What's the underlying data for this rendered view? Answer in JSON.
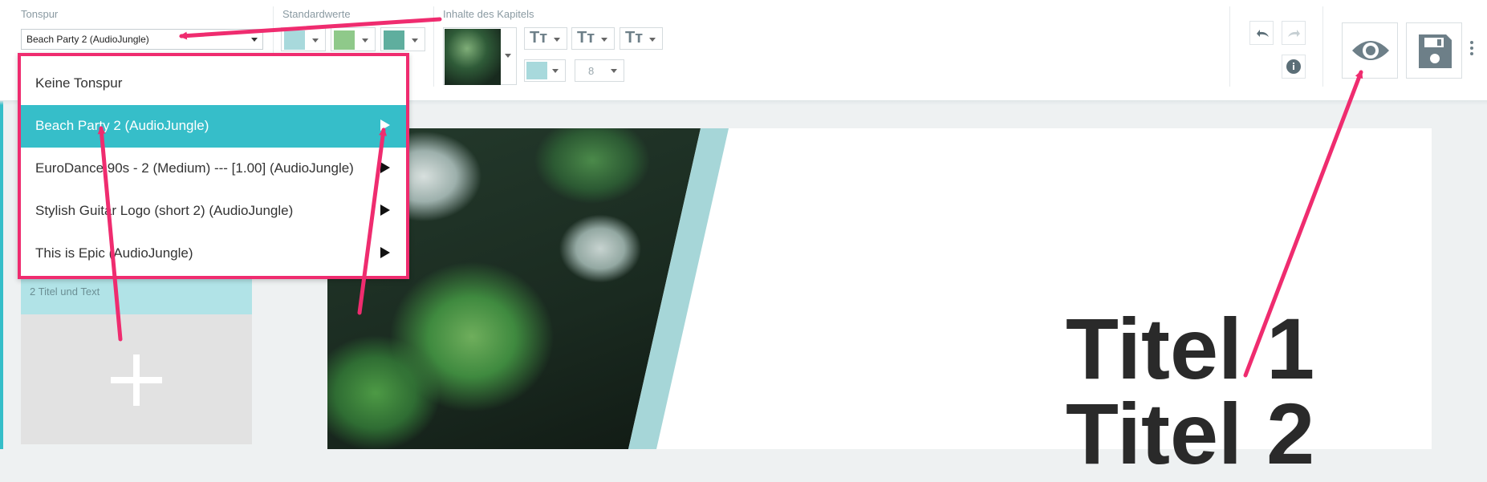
{
  "toolbar": {
    "sections": {
      "tonspur": "Tonspur",
      "standardwerte": "Standardwerte",
      "inhalte": "Inhalte des Kapitels"
    },
    "track_select_value": "Beach Party 2 (AudioJungle)",
    "standard_swatches": [
      "#a8d9dc",
      "#8fc98a",
      "#5fae9e"
    ],
    "font_buttons": [
      "Tт",
      "Tт",
      "Tт"
    ],
    "text_color_swatch": "#a8d9dc",
    "font_size_value": "8",
    "undo_icon": "undo-icon",
    "redo_icon": "redo-icon",
    "info_icon": "info-icon",
    "preview_icon": "eye-icon",
    "save_icon": "floppy-disk-icon",
    "more_icon": "vertical-dots-icon"
  },
  "dropdown": {
    "items": [
      {
        "label": "Keine Tonspur",
        "has_play": false,
        "active": false
      },
      {
        "label": "Beach Party 2 (AudioJungle)",
        "has_play": true,
        "active": true
      },
      {
        "label": "EuroDance 90s - 2 (Medium) --- [1.00] (AudioJungle)",
        "has_play": true,
        "active": false
      },
      {
        "label": "Stylish Guitar Logo (short 2) (AudioJungle)",
        "has_play": true,
        "active": false
      },
      {
        "label": "This is Epic (AudioJungle)",
        "has_play": true,
        "active": false
      }
    ]
  },
  "left_panel": {
    "label": "2 Titel und Text",
    "add_icon": "plus-icon"
  },
  "slide": {
    "title_line_1": "Titel 1",
    "title_line_2": "Titel 2"
  },
  "colors": {
    "accent": "#36bec9",
    "annotation": "#ef2c6f",
    "icon_gray": "#6d7f88"
  }
}
